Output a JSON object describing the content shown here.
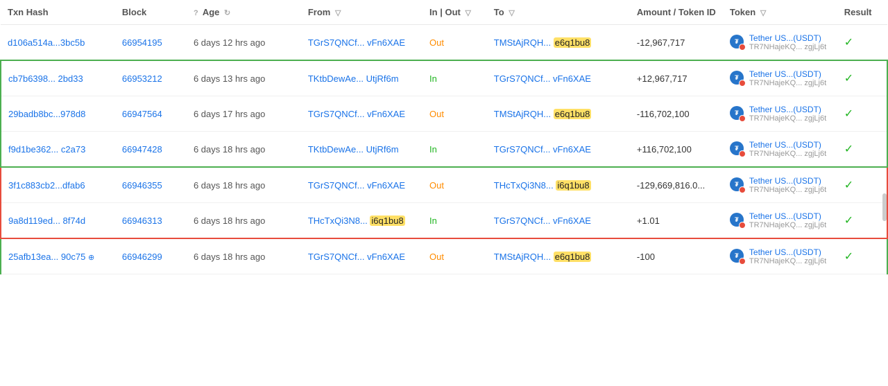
{
  "table": {
    "headers": [
      {
        "key": "txn_hash",
        "label": "Txn Hash",
        "has_help": false,
        "has_filter": false
      },
      {
        "key": "block",
        "label": "Block",
        "has_help": false,
        "has_filter": false
      },
      {
        "key": "age",
        "label": "Age",
        "has_help": true,
        "has_filter": false
      },
      {
        "key": "from",
        "label": "From",
        "has_help": false,
        "has_filter": true
      },
      {
        "key": "in_out",
        "label": "In | Out",
        "has_help": false,
        "has_filter": true
      },
      {
        "key": "to",
        "label": "To",
        "has_help": false,
        "has_filter": true
      },
      {
        "key": "amount",
        "label": "Amount / Token ID",
        "has_help": false,
        "has_filter": false
      },
      {
        "key": "token",
        "label": "Token",
        "has_help": false,
        "has_filter": true
      },
      {
        "key": "result",
        "label": "Result",
        "has_help": false,
        "has_filter": false
      }
    ],
    "rows": [
      {
        "id": "row1",
        "txn_hash": "d106a514a...3bc5b",
        "block": "66954195",
        "age": "6 days 12 hrs ago",
        "from": "TGrS7QNCf... vFn6XAE",
        "direction": "Out",
        "to_main": "TMStAjRQH...",
        "to_highlight": "e6q1bu8",
        "to_highlight_color": "#ffe066",
        "amount": "-12,967,717",
        "amount_sign": "negative",
        "token_name": "Tether US...(USDT)",
        "token_sub": "TR7NHajeKQ... zgjLj6t",
        "result": "success",
        "group": "standalone"
      },
      {
        "id": "row2",
        "txn_hash": "cb7b6398... 2bd33",
        "block": "66953212",
        "age": "6 days 13 hrs ago",
        "from_main": "TKtbDewAe...",
        "from_highlight": "UtjRf6m",
        "from_highlight_color": null,
        "from_is_highlight": false,
        "direction": "In",
        "to": "TGrS7QNCf... vFn6XAE",
        "to_highlight": null,
        "amount": "+12,967,717",
        "amount_sign": "positive",
        "token_name": "Tether US...(USDT)",
        "token_sub": "TR7NHajeKQ... zgjLj6t",
        "result": "success",
        "group": "green-top"
      },
      {
        "id": "row3",
        "txn_hash": "29badb8bc...978d8",
        "block": "66947564",
        "age": "6 days 17 hrs ago",
        "from": "TGrS7QNCf... vFn6XAE",
        "direction": "Out",
        "to_main": "TMStAjRQH...",
        "to_highlight": "e6q1bu8",
        "to_highlight_color": "#ffe066",
        "amount": "-116,702,100",
        "amount_sign": "negative",
        "token_name": "Tether US...(USDT)",
        "token_sub": "TR7NHajeKQ... zgjLj6t",
        "result": "success",
        "group": "green-mid"
      },
      {
        "id": "row4",
        "txn_hash": "f9d1be362... c2a73",
        "block": "66947428",
        "age": "6 days 18 hrs ago",
        "from_main": "TKtbDewAe...",
        "from_highlight": "UtjRf6m",
        "from_highlight_color": null,
        "direction": "In",
        "to": "TGrS7QNCf... vFn6XAE",
        "to_highlight": null,
        "amount": "+116,702,100",
        "amount_sign": "positive",
        "token_name": "Tether US...(USDT)",
        "token_sub": "TR7NHajeKQ... zgjLj6t",
        "result": "success",
        "group": "green-bot"
      },
      {
        "id": "row5",
        "txn_hash": "3f1c883cb2...dfab6",
        "block": "66946355",
        "age": "6 days 18 hrs ago",
        "from": "TGrS7QNCf... vFn6XAE",
        "direction": "Out",
        "to_main": "THcTxQi3N8...",
        "to_highlight": "i6q1bu8",
        "to_highlight_color": "#ffe066",
        "amount": "-129,669,816.0...",
        "amount_sign": "negative",
        "token_name": "Tether US...(USDT)",
        "token_sub": "TR7NHajeKQ... zgjLj6t",
        "result": "success",
        "group": "red-top"
      },
      {
        "id": "row6",
        "txn_hash": "9a8d119ed... 8f74d",
        "block": "66946313",
        "age": "6 days 18 hrs ago",
        "from_main": "THcTxQi3N8...",
        "from_highlight": "i6q1bu8",
        "from_highlight_color": "#ffe066",
        "direction": "In",
        "to": "TGrS7QNCf... vFn6XAE",
        "to_highlight": null,
        "amount": "+1.01",
        "amount_sign": "positive",
        "token_name": "Tether US...(USDT)",
        "token_sub": "TR7NHajeKQ... zgjLj6t",
        "result": "success",
        "group": "red-bot"
      },
      {
        "id": "row7",
        "txn_hash": "25afb13ea... 90c75",
        "txn_has_icon": true,
        "block": "66946299",
        "age": "6 days 18 hrs ago",
        "from": "TGrS7QNCf... vFn6XAE",
        "direction": "Out",
        "to_main": "TMStAjRQH...",
        "to_highlight": "e6q1bu8",
        "to_highlight_color": "#ffe066",
        "amount": "-100",
        "amount_sign": "negative",
        "token_name": "Tether US...(USDT)",
        "token_sub": "TR7NHajeKQ... zgjLj6t",
        "result": "success",
        "group": "green2-top"
      }
    ]
  }
}
